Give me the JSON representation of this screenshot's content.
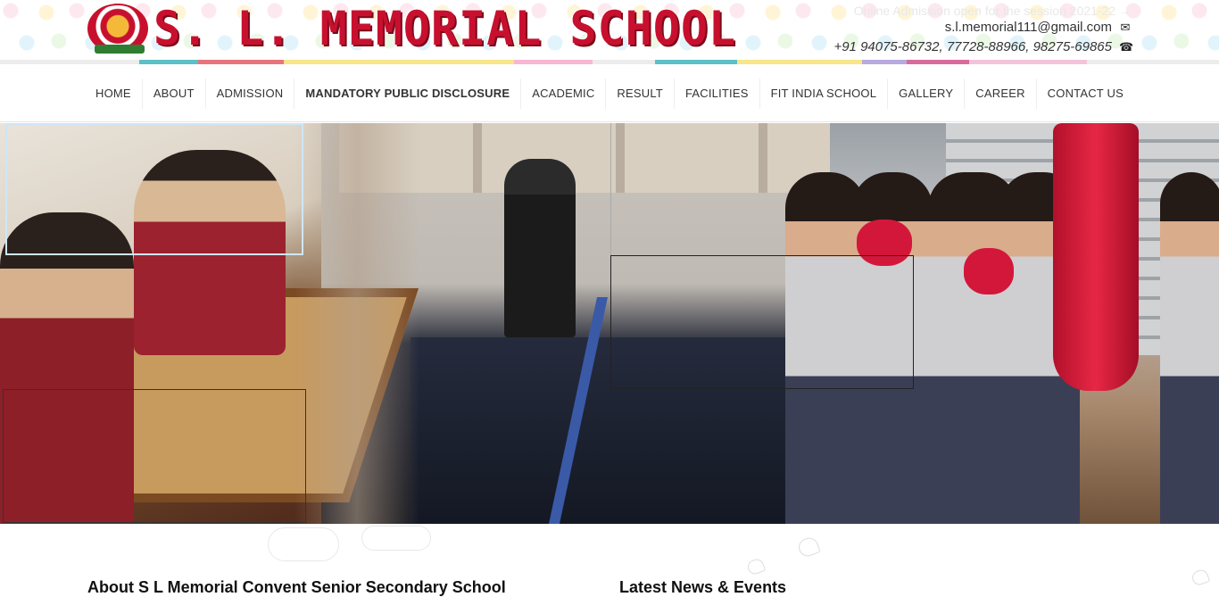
{
  "header": {
    "school_name": "S. L. MEMORIAL SCHOOL",
    "logo_icon": "school-crest-icon",
    "marquee_text": "Online Admission open for the session 2021-22 →",
    "email": "s.l.memorial111@gmail.com",
    "email_icon": "envelope-icon",
    "phones": "+91 94075-86732, 77728-88966, 98275-69865",
    "phone_icon": "phone-icon"
  },
  "colors": {
    "brand_red": "#c8102e",
    "stripe": [
      "#5bc0c8",
      "#e8747c",
      "#f9e58a",
      "#f7b6d2",
      "#5bc0c8",
      "#f9e58a",
      "#b8a9e0",
      "#d96b9c",
      "#f3c3da"
    ]
  },
  "nav": {
    "items": [
      {
        "label": "HOME"
      },
      {
        "label": "ABOUT"
      },
      {
        "label": "ADMISSION"
      },
      {
        "label": "MANDATORY PUBLIC DISCLOSURE"
      },
      {
        "label": "ACADEMIC"
      },
      {
        "label": "RESULT"
      },
      {
        "label": "FACILITIES"
      },
      {
        "label": "FIT INDIA SCHOOL"
      },
      {
        "label": "GALLERY"
      },
      {
        "label": "CAREER"
      },
      {
        "label": "CONTACT US"
      }
    ]
  },
  "hero": {
    "slide_description_icons": [
      "carrom-board-icon",
      "table-tennis-icon",
      "boxing-icon"
    ]
  },
  "sections": {
    "about_title": "About S L Memorial Convent Senior Secondary School",
    "notice_title": "Latest News & Events"
  }
}
